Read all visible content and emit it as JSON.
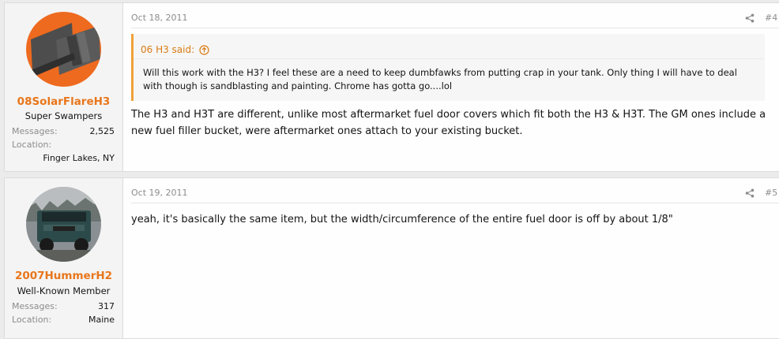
{
  "posts": [
    {
      "username": "08SolarFlareH3",
      "user_title": "Super Swampers",
      "stats": {
        "messages_label": "Messages:",
        "messages_value": "2,525",
        "location_label": "Location:",
        "location_value": "Finger Lakes, NY"
      },
      "date": "Oct 18, 2011",
      "post_number": "#4",
      "quote": {
        "author": "06 H3 said:",
        "text": "Will this work with the H3? I feel these are a need to keep dumbfawks from putting crap in your tank. Only thing I will have to deal with though is sandblasting and painting. Chrome has gotta go....lol"
      },
      "message": "The H3 and H3T are different, unlike most aftermarket fuel door covers which fit both the H3 & H3T. The GM ones include a new fuel filler bucket, were aftermarket ones attach to your existing bucket."
    },
    {
      "username": "2007HummerH2",
      "user_title": "Well-Known Member",
      "stats": {
        "messages_label": "Messages:",
        "messages_value": "317",
        "location_label": "Location:",
        "location_value": "Maine"
      },
      "date": "Oct 19, 2011",
      "post_number": "#5",
      "message": "yeah, it's basically the same item, but the width/circumference of the entire fuel door is off by about 1/8\""
    }
  ],
  "colors": {
    "username": "#e8761b",
    "quote_border": "#f1a13a",
    "muted": "#8c8c8c"
  }
}
